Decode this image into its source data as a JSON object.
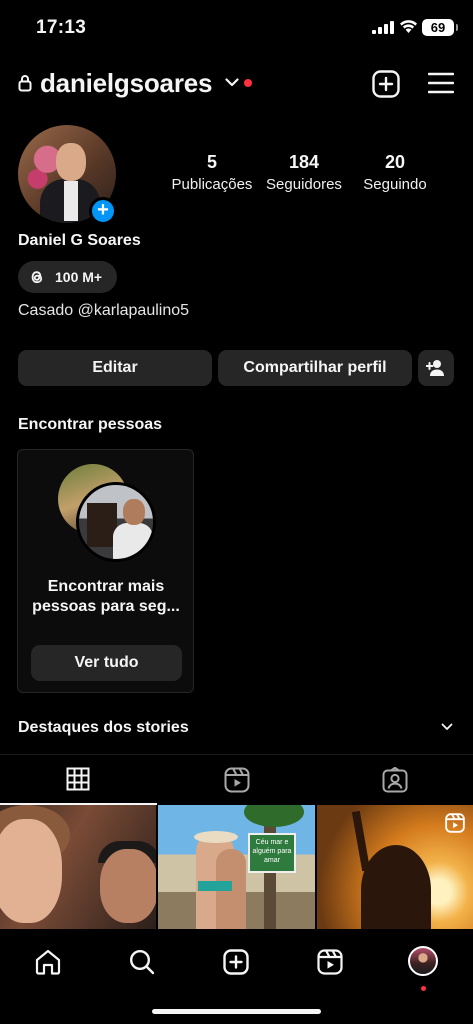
{
  "status_bar": {
    "time": "17:13",
    "battery": "69"
  },
  "header": {
    "username": "danielgsoares"
  },
  "profile": {
    "name": "Daniel G Soares",
    "stats": [
      {
        "value": "5",
        "label": "Publicações"
      },
      {
        "value": "184",
        "label": "Seguidores"
      },
      {
        "value": "20",
        "label": "Seguindo"
      }
    ],
    "threads_badge": "100 M+",
    "bio": "Casado @karlapaulino5",
    "add_story_glyph": "+"
  },
  "actions": {
    "edit": "Editar",
    "share": "Compartilhar perfil"
  },
  "find_people": {
    "title": "Encontrar pessoas",
    "card_text_line1": "Encontrar mais",
    "card_text_line2": "pessoas para seg...",
    "button": "Ver tudo"
  },
  "highlights": {
    "title": "Destaques dos stories"
  },
  "grid_posts": [
    {
      "type": "photo"
    },
    {
      "type": "photo",
      "sign_text": "Céu mar e alguém para amar"
    },
    {
      "type": "reel"
    }
  ],
  "colors": {
    "accent": "#0095f6",
    "notification": "#ff3040",
    "button_bg": "#262626",
    "background": "#000000"
  },
  "icons": {
    "header": [
      "lock-icon",
      "chevron-down-icon",
      "new-post-icon",
      "menu-icon"
    ],
    "tabs": [
      "grid-icon",
      "reels-icon",
      "tagged-icon"
    ],
    "nav": [
      "home-icon",
      "search-icon",
      "create-icon",
      "reels-icon",
      "profile-avatar"
    ]
  }
}
